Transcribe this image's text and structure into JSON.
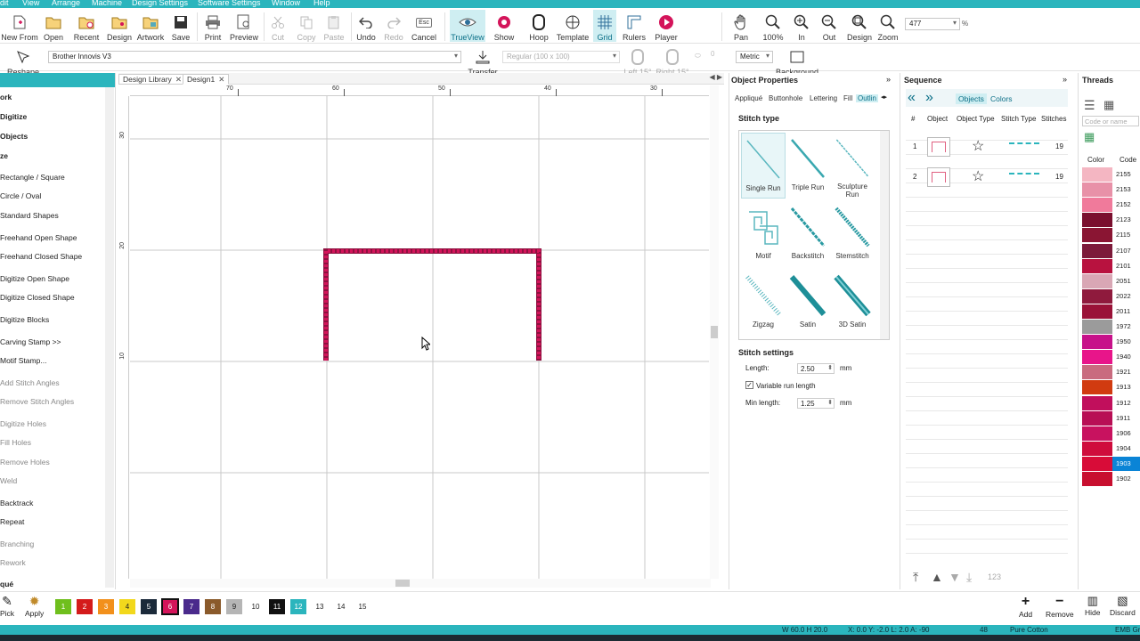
{
  "menubar": {
    "items": [
      "dit",
      "View",
      "Arrange",
      "Machine",
      "Design Settings",
      "Software Settings",
      "Window",
      "Help"
    ]
  },
  "toolbar": {
    "new_from": "New From",
    "open": "Open",
    "recent": "Recent",
    "design": "Design",
    "artwork": "Artwork",
    "save": "Save",
    "print": "Print",
    "preview": "Preview",
    "cut": "Cut",
    "copy": "Copy",
    "paste": "Paste",
    "undo": "Undo",
    "redo": "Redo",
    "cancel": "Cancel",
    "esc": "Esc",
    "trueview": "TrueView",
    "show": "Show",
    "hoop": "Hoop",
    "template": "Template",
    "grid": "Grid",
    "rulers": "Rulers",
    "player": "Player",
    "pan": "Pan",
    "zoom100": "100%",
    "zoom_in": "In",
    "zoom_out": "Out",
    "zoom_design": "Design",
    "zoom": "Zoom",
    "zoom_value": "477",
    "percent": "%"
  },
  "toolbar2": {
    "reshape": "Reshape",
    "machine": "Brother Innovis V3",
    "transfer": "Transfer",
    "hoop_size": "Regular (100 x 100)",
    "left_angle": "Left 15°",
    "right_angle": "Right 15°",
    "zero": "0",
    "units": "Metric",
    "background": "Background"
  },
  "leftpanel": {
    "items": [
      {
        "label": "ork",
        "style": "sec"
      },
      {
        "label": "Digitize",
        "style": "sec"
      },
      {
        "label": "Objects",
        "style": "sec"
      },
      {
        "label": "ze",
        "style": "sec"
      },
      {
        "label": "Rectangle / Square",
        "style": ""
      },
      {
        "label": "Circle / Oval",
        "style": ""
      },
      {
        "label": "Standard Shapes",
        "style": ""
      },
      {
        "label": "Freehand Open Shape",
        "style": ""
      },
      {
        "label": "Freehand Closed Shape",
        "style": ""
      },
      {
        "label": "Digitize Open Shape",
        "style": ""
      },
      {
        "label": "Digitize Closed Shape",
        "style": ""
      },
      {
        "label": "Digitize Blocks",
        "style": ""
      },
      {
        "label": "Carving Stamp >>",
        "style": ""
      },
      {
        "label": "Motif Stamp...",
        "style": ""
      },
      {
        "label": "Add Stitch Angles",
        "style": "dim"
      },
      {
        "label": "Remove Stitch Angles",
        "style": "dim"
      },
      {
        "label": "Digitize Holes",
        "style": "dim"
      },
      {
        "label": "Fill Holes",
        "style": "dim"
      },
      {
        "label": "Remove Holes",
        "style": "dim"
      },
      {
        "label": "Weld",
        "style": "dim"
      },
      {
        "label": "Backtrack",
        "style": ""
      },
      {
        "label": "Repeat",
        "style": ""
      },
      {
        "label": "Branching",
        "style": "dim"
      },
      {
        "label": "Rework",
        "style": "dim"
      },
      {
        "label": "qué",
        "style": "sec"
      }
    ]
  },
  "tabs": {
    "library": "Design Library",
    "design": "Design1",
    "close": "✕"
  },
  "ruler": {
    "top": [
      "70",
      "60",
      "50",
      "40",
      "30"
    ],
    "left": [
      "30",
      "20",
      "10"
    ]
  },
  "canvas": {
    "stitch_color": "#d4145a",
    "stitch_edge": "#8e1140"
  },
  "props": {
    "title": "Object Properties",
    "tabs": [
      "Appliqué",
      "Buttonhole",
      "Lettering",
      "Fill",
      "Outlin"
    ],
    "stitch_type_title": "Stitch type",
    "options": [
      "Single Run",
      "Triple Run",
      "Sculpture Run",
      "Motif",
      "Backstitch",
      "Stemstitch",
      "Zigzag",
      "Satin",
      "3D Satin"
    ],
    "settings_title": "Stitch settings",
    "length_label": "Length:",
    "length_value": "2.50",
    "mm": "mm",
    "variable_label": "Variable run length",
    "min_label": "Min length:",
    "min_value": "1.25"
  },
  "sequence": {
    "title": "Sequence",
    "objects_tab": "Objects",
    "colors_tab": "Colors",
    "headers": [
      "#",
      "Object",
      "Object Type",
      "Stitch Type",
      "Stitches"
    ],
    "rows": [
      {
        "num": "1",
        "stitches": "19"
      },
      {
        "num": "2",
        "stitches": "19"
      }
    ],
    "count_badge": "123"
  },
  "threads": {
    "title": "Threads",
    "search_placeholder": "Code or name",
    "col_color": "Color",
    "col_code": "Code",
    "rows": [
      {
        "code": "2155",
        "color": "#f4b6c2"
      },
      {
        "code": "2153",
        "color": "#e891a8"
      },
      {
        "code": "2152",
        "color": "#f07a9b"
      },
      {
        "code": "2123",
        "color": "#7a0f2e"
      },
      {
        "code": "2115",
        "color": "#8a1533"
      },
      {
        "code": "2107",
        "color": "#7d1a3a"
      },
      {
        "code": "2101",
        "color": "#b8123f"
      },
      {
        "code": "2051",
        "color": "#d9a7b5"
      },
      {
        "code": "2022",
        "color": "#8f1a3d"
      },
      {
        "code": "2011",
        "color": "#9a1238"
      },
      {
        "code": "1972",
        "color": "#9b9b9b"
      },
      {
        "code": "1950",
        "color": "#c7118a"
      },
      {
        "code": "1940",
        "color": "#e8158a"
      },
      {
        "code": "1921",
        "color": "#c96b7f"
      },
      {
        "code": "1913",
        "color": "#d13b10"
      },
      {
        "code": "1912",
        "color": "#c10f5c"
      },
      {
        "code": "1911",
        "color": "#b80f55"
      },
      {
        "code": "1906",
        "color": "#c8125f"
      },
      {
        "code": "1904",
        "color": "#cf0c3c"
      },
      {
        "code": "1903",
        "color": "#d80c38"
      },
      {
        "code": "1902",
        "color": "#c80f2f"
      }
    ]
  },
  "palette": {
    "pick": "Pick",
    "apply": "Apply",
    "colors": [
      {
        "n": "1",
        "c": "#6fbf1d"
      },
      {
        "n": "2",
        "c": "#d41b1b"
      },
      {
        "n": "3",
        "c": "#f2901c"
      },
      {
        "n": "4",
        "c": "#f2d81c"
      },
      {
        "n": "5",
        "c": "#1b2a3a"
      },
      {
        "n": "6",
        "c": "#d4145a"
      },
      {
        "n": "7",
        "c": "#4a2a8c"
      },
      {
        "n": "8",
        "c": "#8a5a2b"
      },
      {
        "n": "9",
        "c": "#b5b5b5"
      },
      {
        "n": "10",
        "c": "#ffffff"
      },
      {
        "n": "11",
        "c": "#111111"
      },
      {
        "n": "12",
        "c": "#2bb5bd"
      },
      {
        "n": "13",
        "c": "#ffffff"
      },
      {
        "n": "14",
        "c": "#ffffff"
      },
      {
        "n": "15",
        "c": "#ffffff"
      }
    ],
    "add": "Add",
    "remove": "Remove",
    "hide": "Hide",
    "discard": "Discard"
  },
  "status": {
    "dims": "W  60.0 H  20.0",
    "coords": "X:   0.0 Y:  -2.0 L:   2.0 A:  -90",
    "count": "48",
    "thread": "Pure Cotton",
    "format": "EMB Gr"
  }
}
